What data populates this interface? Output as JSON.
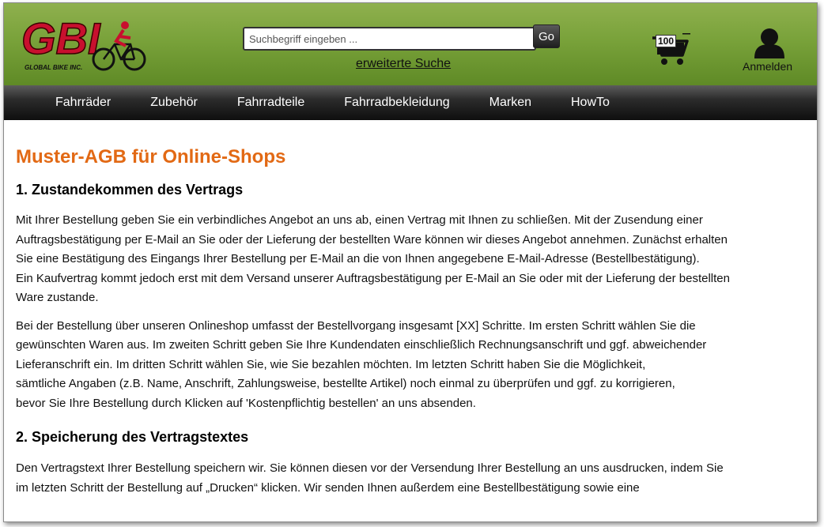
{
  "brand": {
    "logo_text": "GBI",
    "logo_subtext": "GLOBAL BIKE INC.",
    "primary_color": "#e26914",
    "header_green": "#7aa33a"
  },
  "search": {
    "placeholder": "Suchbegriff eingeben ...",
    "value": "",
    "go_label": "Go",
    "advanced_label": "erweiterte Suche"
  },
  "cart": {
    "count": "100",
    "icon": "shopping-cart-icon"
  },
  "account": {
    "login_label": "Anmelden",
    "icon": "user-icon"
  },
  "nav": {
    "items": [
      "Fahrräder",
      "Zubehör",
      "Fahrradteile",
      "Fahrradbekleidung",
      "Marken",
      "HowTo"
    ]
  },
  "page": {
    "title": "Muster-AGB für Online-Shops",
    "sections": [
      {
        "heading": "1. Zustandekommen des Vertrags",
        "paragraphs": [
          [
            "Mit Ihrer Bestellung geben Sie ein verbindliches Angebot an uns ab, einen Vertrag mit Ihnen zu schließen. Mit der Zusendung einer",
            "Auftragsbestätigung per E-Mail an Sie oder der Lieferung der bestellten Ware können wir dieses Angebot annehmen. Zunächst erhalten",
            "Sie eine Bestätigung des Eingangs Ihrer Bestellung per E-Mail an die von Ihnen angegebene E-Mail-Adresse (Bestellbestätigung).",
            "Ein Kaufvertrag kommt jedoch erst mit dem Versand unserer Auftragsbestätigung per E-Mail an Sie oder mit der Lieferung der bestellten",
            "Ware zustande."
          ],
          [
            "Bei der Bestellung über unseren Onlineshop umfasst der Bestellvorgang insgesamt [XX] Schritte. Im ersten Schritt wählen Sie die",
            "gewünschten Waren aus. Im zweiten Schritt geben Sie Ihre Kundendaten einschließlich Rechnungsanschrift und ggf. abweichender",
            "Lieferanschrift ein. Im dritten Schritt wählen Sie, wie Sie bezahlen möchten. Im letzten Schritt haben Sie die Möglichkeit,",
            "sämtliche Angaben (z.B. Name, Anschrift, Zahlungsweise, bestellte Artikel) noch einmal zu überprüfen und ggf. zu korrigieren,",
            "bevor Sie Ihre Bestellung durch Klicken auf 'Kostenpflichtig bestellen' an uns absenden."
          ]
        ]
      },
      {
        "heading": "2. Speicherung des Vertragstextes",
        "paragraphs": [
          [
            "Den Vertragstext Ihrer Bestellung speichern wir. Sie können diesen vor der Versendung Ihrer Bestellung an uns ausdrucken, indem Sie",
            "im letzten Schritt der Bestellung auf „Drucken“ klicken. Wir senden Ihnen außerdem eine Bestellbestätigung sowie eine"
          ]
        ]
      }
    ]
  }
}
